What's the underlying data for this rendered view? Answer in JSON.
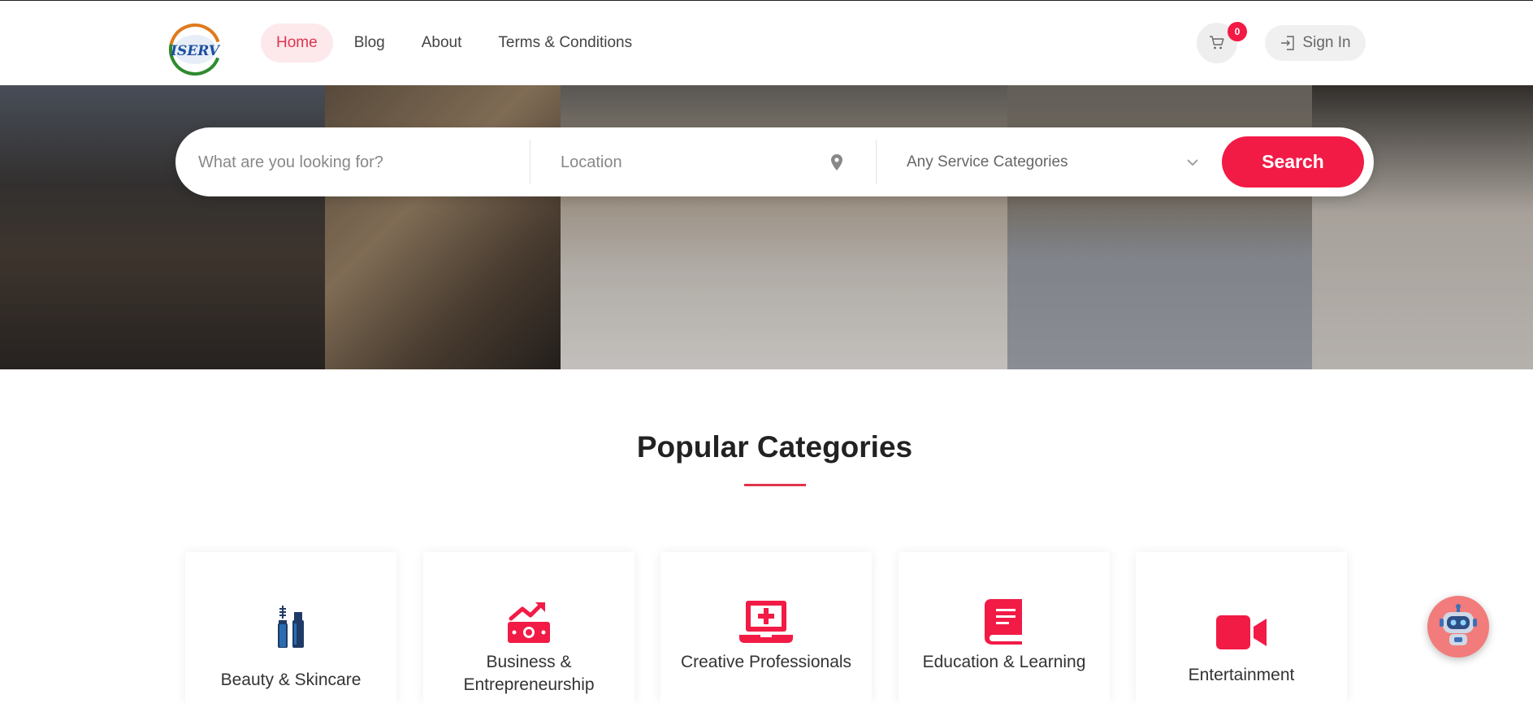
{
  "header": {
    "logo_text": "ISERV",
    "nav": [
      {
        "label": "Home",
        "active": true
      },
      {
        "label": "Blog",
        "active": false
      },
      {
        "label": "About",
        "active": false
      },
      {
        "label": "Terms & Conditions",
        "active": false
      }
    ],
    "cart_icon": "cart-icon",
    "cart_count": "0",
    "signin_label": "Sign In",
    "signin_icon": "sign-in-icon"
  },
  "search": {
    "query_placeholder": "What are you looking for?",
    "location_placeholder": "Location",
    "location_icon": "map-pin-icon",
    "category_selected": "Any Service Categories",
    "category_icon": "chevron-down-icon",
    "button_label": "Search"
  },
  "categories": {
    "title": "Popular Categories",
    "items": [
      {
        "label": "Beauty & Skincare",
        "icon": "mascara-icon"
      },
      {
        "label": "Business & Entrepreneurship",
        "icon": "money-growth-icon"
      },
      {
        "label": "Creative Professionals",
        "icon": "laptop-medical-icon"
      },
      {
        "label": "Education & Learning",
        "icon": "book-icon"
      },
      {
        "label": "Entertainment",
        "icon": "video-camera-icon"
      }
    ]
  },
  "chatbot": {
    "icon": "robot-icon"
  },
  "colors": {
    "accent": "#f21b46",
    "nav_active_bg": "#fde8ec",
    "nav_active_text": "#e0344d",
    "icon_navy": "#1f3a66"
  }
}
